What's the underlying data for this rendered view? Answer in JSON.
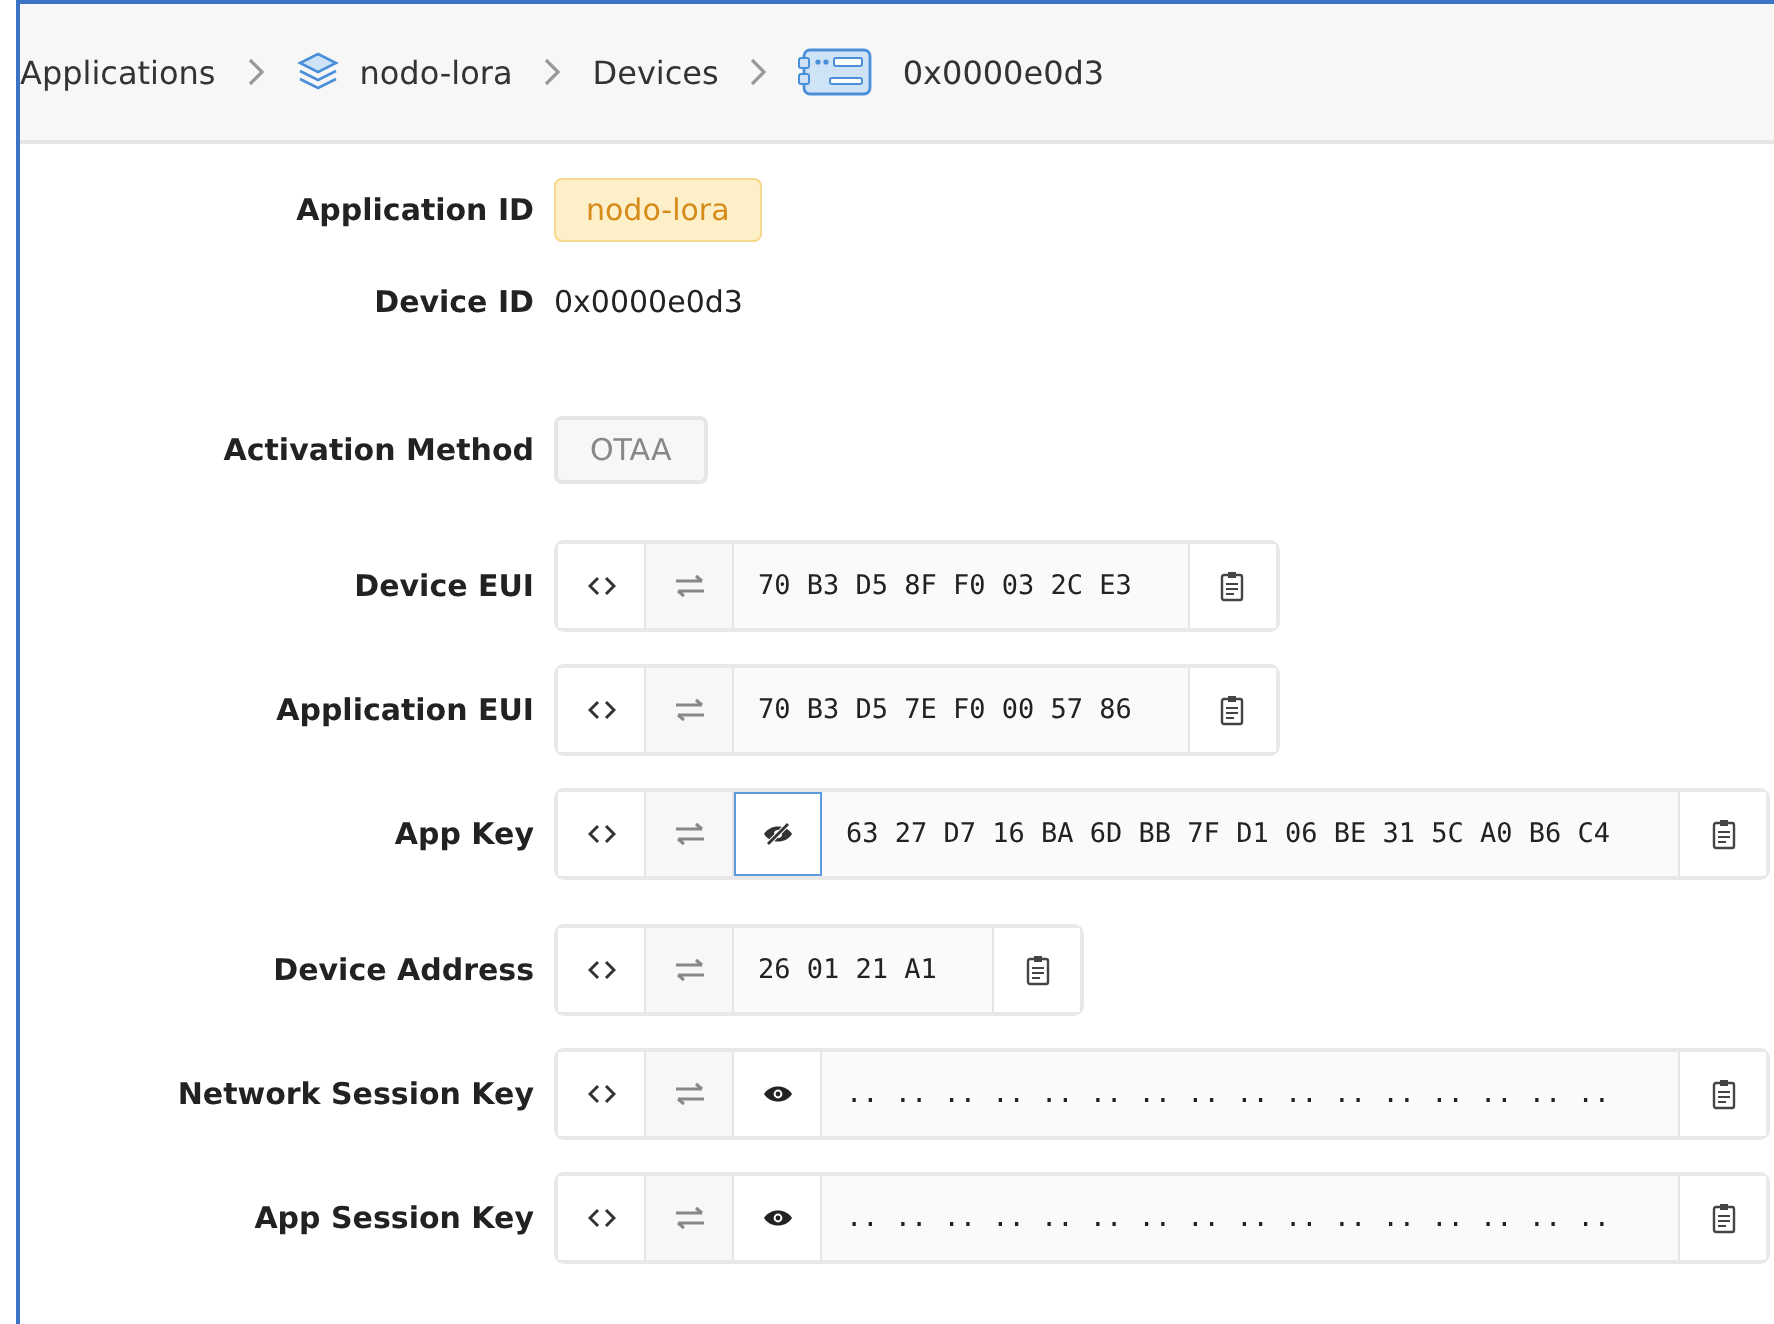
{
  "breadcrumb": [
    {
      "label": "Applications",
      "kind": "plain"
    },
    {
      "label": "nodo-lora",
      "kind": "application"
    },
    {
      "label": "Devices",
      "kind": "plain"
    },
    {
      "label": "0x0000e0d3",
      "kind": "device"
    }
  ],
  "sections": [
    [
      {
        "label": "Application ID",
        "kind": "badge",
        "value": "nodo-lora"
      },
      {
        "label": "Device ID",
        "kind": "text",
        "value": "0x0000e0d3"
      }
    ],
    [
      {
        "label": "Activation Method",
        "kind": "tag",
        "value": "OTAA"
      }
    ],
    [
      {
        "label": "Device EUI",
        "kind": "key",
        "value": "70 B3 D5 8F F0 03 2C E3"
      },
      {
        "label": "Application EUI",
        "kind": "key",
        "value": "70 B3 D5 7E F0 00 57 86"
      },
      {
        "label": "App Key",
        "kind": "secret",
        "masked": false,
        "focused": true,
        "value": "63 27 D7 16 BA 6D BB 7F D1 06 BE 31 5C A0 B6 C4"
      }
    ],
    [
      {
        "label": "Device Address",
        "kind": "key",
        "value": "26 01 21 A1"
      },
      {
        "label": "Network Session Key",
        "kind": "secret",
        "masked": true,
        "focused": false,
        "value": ".. .. .. .. .. .. .. .. .. .. .. .. .. .. .. .."
      },
      {
        "label": "App Session Key",
        "kind": "secret",
        "masked": true,
        "focused": false,
        "value": ".. .. .. .. .. .. .. .. .. .. .. .. .. .. .. .."
      }
    ]
  ]
}
